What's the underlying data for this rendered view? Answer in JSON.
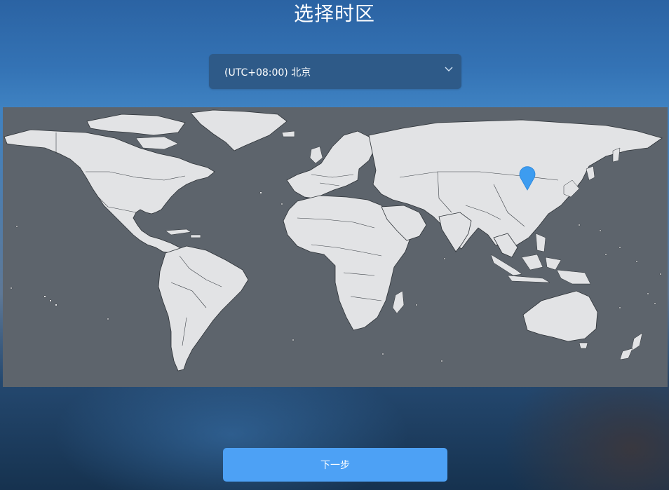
{
  "page": {
    "title": "选择时区"
  },
  "timezone_select": {
    "value": "(UTC+08:00) 北京",
    "icon": "chevron-down-icon"
  },
  "map": {
    "marker_icon": "location-pin-icon",
    "marker_color": "#3d9cf0",
    "selected_city": "北京"
  },
  "footer": {
    "next_label": "下一步"
  },
  "colors": {
    "accent": "#4da1f5",
    "map_ocean": "#5d646c",
    "map_land": "#e2e3e5"
  }
}
